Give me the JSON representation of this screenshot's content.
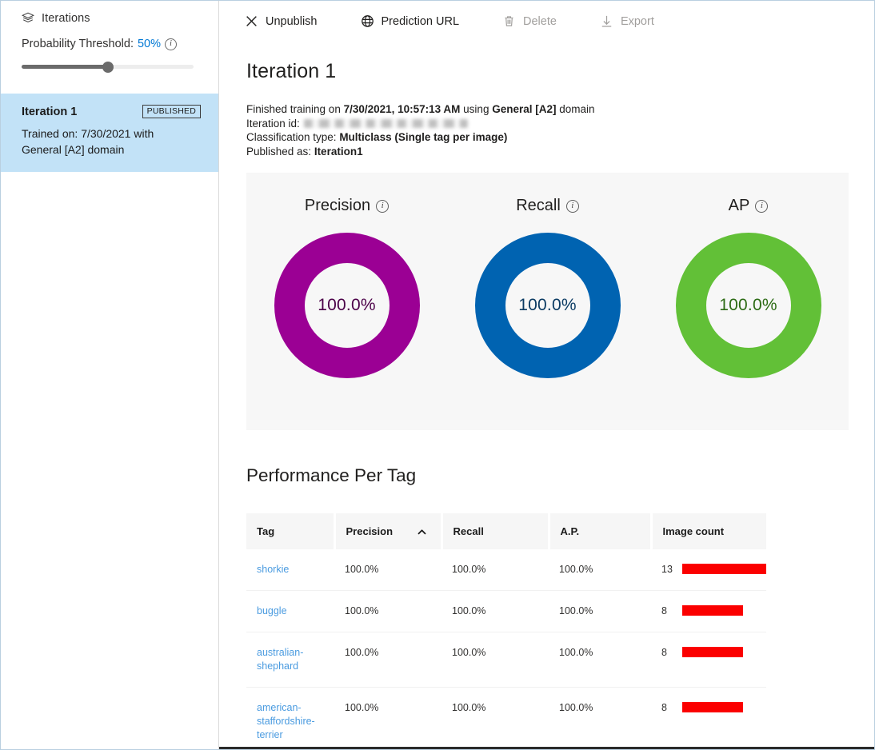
{
  "sidebar": {
    "header_label": "Iterations",
    "header_icon": "layers-icon",
    "threshold": {
      "label_prefix": "Probability Threshold:",
      "value": "50%",
      "percent": 50,
      "info_icon": "info-icon",
      "info_glyph": "i"
    },
    "iteration_card": {
      "title": "Iteration 1",
      "badge": "PUBLISHED",
      "subtitle": "Trained on: 7/30/2021 with General [A2] domain",
      "selected_bg": "#c2e2f7"
    }
  },
  "toolbar": {
    "buttons": [
      {
        "label": "Unpublish",
        "icon": "close-icon",
        "disabled": false
      },
      {
        "label": "Prediction URL",
        "icon": "globe-icon",
        "disabled": false
      },
      {
        "label": "Delete",
        "icon": "trash-icon",
        "disabled": true
      },
      {
        "label": "Export",
        "icon": "download-icon",
        "disabled": true
      }
    ]
  },
  "main": {
    "page_title": "Iteration 1",
    "meta": {
      "finished_prefix": "Finished training on ",
      "finished_date": "7/30/2021, 10:57:13 AM",
      "finished_middle": " using ",
      "domain": "General [A2]",
      "finished_suffix": " domain",
      "iteration_id_label": "Iteration id:",
      "iteration_id_value": "",
      "classification_label": "Classification type: ",
      "classification_value": "Multiclass (Single tag per image)",
      "published_label": "Published as: ",
      "published_value": "Iteration1"
    },
    "section_title": "Performance Per Tag"
  },
  "chart_data": [
    {
      "type": "pie",
      "title": "Precision",
      "info_icon": "info-icon",
      "values": [
        100.0
      ],
      "labels": [
        "Precision"
      ],
      "display_value": "100.0%",
      "max": 100,
      "color": "#9b0094",
      "text_color": "#4b0048"
    },
    {
      "type": "pie",
      "title": "Recall",
      "info_icon": "info-icon",
      "values": [
        100.0
      ],
      "labels": [
        "Recall"
      ],
      "display_value": "100.0%",
      "max": 100,
      "color": "#0063b1",
      "text_color": "#0b3b63"
    },
    {
      "type": "pie",
      "title": "AP",
      "info_icon": "info-icon",
      "values": [
        100.0
      ],
      "labels": [
        "AP"
      ],
      "display_value": "100.0%",
      "max": 100,
      "color": "#62c037",
      "text_color": "#2d6b15"
    }
  ],
  "table": {
    "columns": [
      "Tag",
      "Precision",
      "Recall",
      "A.P.",
      "Image count"
    ],
    "sorted_column": "Precision",
    "sort_direction": "asc",
    "sort_icon": "chevron-up-icon",
    "bar_color": "#fb0000",
    "max_count": 13,
    "rows": [
      {
        "tag": "shorkie",
        "precision": "100.0%",
        "recall": "100.0%",
        "ap": "100.0%",
        "image_count": "13",
        "count_value": 13
      },
      {
        "tag": "buggle",
        "precision": "100.0%",
        "recall": "100.0%",
        "ap": "100.0%",
        "image_count": "8",
        "count_value": 8
      },
      {
        "tag": "australian-shephard",
        "precision": "100.0%",
        "recall": "100.0%",
        "ap": "100.0%",
        "image_count": "8",
        "count_value": 8
      },
      {
        "tag": "american-staffordshire-terrier",
        "precision": "100.0%",
        "recall": "100.0%",
        "ap": "100.0%",
        "image_count": "8",
        "count_value": 8
      }
    ]
  }
}
